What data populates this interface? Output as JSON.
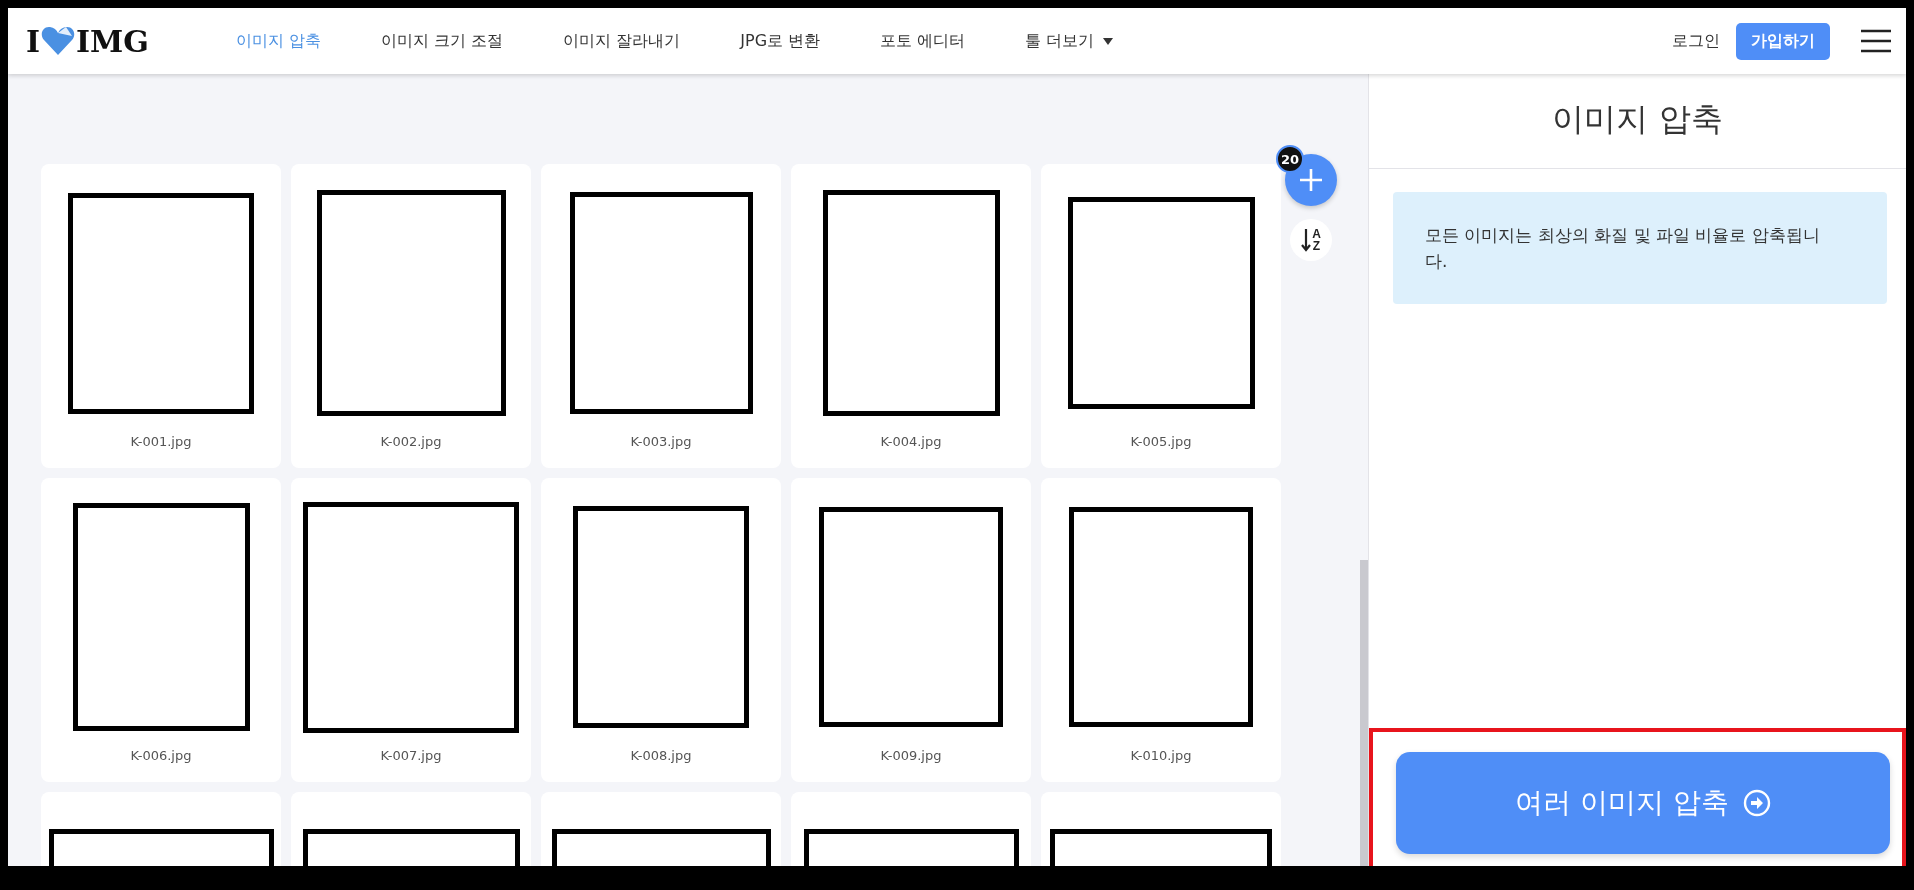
{
  "header": {
    "logo": {
      "left": "I",
      "right": "IMG"
    },
    "nav": [
      {
        "label": "이미지 압축",
        "selected": true
      },
      {
        "label": "이미지 크기 조절",
        "selected": false
      },
      {
        "label": "이미지 잘라내기",
        "selected": false
      },
      {
        "label": "JPG로 변환",
        "selected": false
      },
      {
        "label": "포토 에디터",
        "selected": false
      },
      {
        "label": "툴 더보기",
        "selected": false,
        "kind": "dropdown"
      }
    ],
    "login": "로그인",
    "signup": "가입하기"
  },
  "workspace": {
    "file_count": "20",
    "sort": {
      "top": "A",
      "bottom": "Z"
    },
    "files": [
      {
        "name": "K-001.jpg",
        "kind": "picture"
      },
      {
        "name": "K-002.jpg",
        "kind": "picture"
      },
      {
        "name": "K-003.jpg",
        "kind": "picture"
      },
      {
        "name": "K-004.jpg",
        "kind": "picture"
      },
      {
        "name": "K-005.jpg",
        "kind": "picture"
      },
      {
        "name": "K-006.jpg",
        "kind": "picture"
      },
      {
        "name": "K-007.jpg",
        "kind": "picture"
      },
      {
        "name": "K-008.jpg",
        "kind": "picture"
      },
      {
        "name": "K-009.jpg",
        "kind": "picture"
      },
      {
        "name": "K-010.jpg",
        "kind": "picture"
      },
      {
        "kind": "picture"
      },
      {
        "kind": "picture"
      },
      {
        "kind": "picture"
      },
      {
        "kind": "picture"
      },
      {
        "kind": "picture"
      }
    ]
  },
  "sidebar": {
    "title": "이미지 압축",
    "info": "모든 이미지는 최상의 화질 및 파일 비율로 압축됩니다.",
    "action": {
      "label": "여러 이미지 압축",
      "highlighted": true
    }
  }
}
